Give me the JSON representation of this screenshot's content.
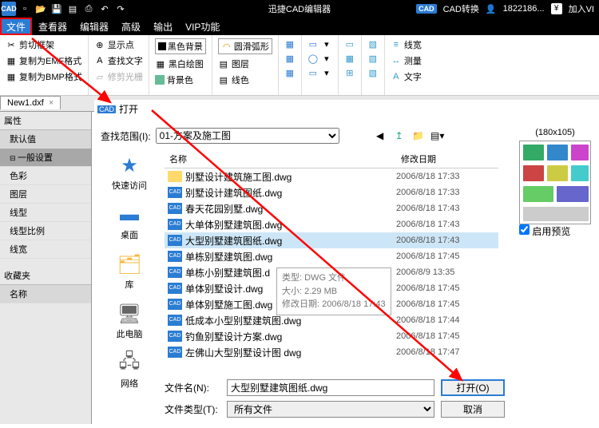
{
  "titlebar": {
    "app_title": "迅捷CAD编辑器",
    "cad_convert": "CAD转换",
    "user": "1822186...",
    "join_vip": "加入VI"
  },
  "menubar": {
    "file": "文件",
    "view": "查看器",
    "editor": "编辑器",
    "advanced": "高级",
    "output": "输出",
    "vip": "VIP功能"
  },
  "ribbon": {
    "g1": {
      "cut_frame": "剪切框架",
      "copy_emf": "复制为EMF格式",
      "copy_bmp": "复制为BMP格式"
    },
    "g2": {
      "show_point": "显示点",
      "find_text": "查找文字",
      "trim_cursor": "修剪光栅"
    },
    "g3": {
      "black_bg": "黑色背景",
      "bw_draw": "黑白绘图",
      "bg_color": "背景色"
    },
    "g4": {
      "smooth_arc": "圆滑弧形",
      "layer": "图层",
      "line_color": "线色"
    },
    "g5": {
      "line_width": "线宽",
      "measure": "测量",
      "text": "文字"
    }
  },
  "tab": {
    "name": "New1.dxf"
  },
  "leftpanel": {
    "props": "属性",
    "default": "默认值",
    "general": "一般设置",
    "rows": [
      "色彩",
      "图层",
      "线型",
      "线型比例",
      "线宽"
    ],
    "fav": "收藏夹",
    "name_label": "名称"
  },
  "dialog": {
    "title": "打开",
    "lookin_label": "查找范围(I):",
    "lookin_value": "01-方案及施工图",
    "places": {
      "quick": "快速访问",
      "desktop": "桌面",
      "lib": "库",
      "pc": "此电脑",
      "net": "网络"
    },
    "cols": {
      "name": "名称",
      "date": "修改日期",
      "extra": "^"
    },
    "files": [
      {
        "type": "fld",
        "name": "别墅设计建筑施工图.dwg",
        "date": "2006/8/18 17:33"
      },
      {
        "type": "dwg",
        "name": "别墅设计建筑图纸.dwg",
        "date": "2006/8/18 17:33"
      },
      {
        "type": "dwg",
        "name": "春天花园别墅.dwg",
        "date": "2006/8/18 17:43"
      },
      {
        "type": "dwg",
        "name": "大单体别墅建筑图.dwg",
        "date": "2006/8/18 17:43"
      },
      {
        "type": "dwg",
        "name": "大型别墅建筑图纸.dwg",
        "date": "2006/8/18 17:43",
        "sel": true
      },
      {
        "type": "dwg",
        "name": "单栋别墅建筑图.dwg",
        "date": "2006/8/18 17:45"
      },
      {
        "type": "dwg",
        "name": "单栋小别墅建筑图.d",
        "date": "2006/8/9 13:35"
      },
      {
        "type": "dwg",
        "name": "单体别墅设计.dwg",
        "date": "2006/8/18 17:45"
      },
      {
        "type": "dwg",
        "name": "单体别墅施工图.dwg",
        "date": "2006/8/18 17:45"
      },
      {
        "type": "dwg",
        "name": "低成本小型别墅建筑图.dwg",
        "date": "2006/8/18 17:44"
      },
      {
        "type": "dwg",
        "name": "钓鱼别墅设计方案.dwg",
        "date": "2006/8/18 17:45"
      },
      {
        "type": "dwg",
        "name": "左佛山大型别墅设计图 dwg",
        "date": "2006/8/18 17:47"
      }
    ],
    "tooltip": {
      "l1": "类型: DWG 文件",
      "l2": "大小: 2.29 MB",
      "l3": "修改日期: 2006/8/18 17:43"
    },
    "preview": {
      "size": "(180x105)",
      "enable": "启用预览"
    },
    "filename_label": "文件名(N):",
    "filename_value": "大型别墅建筑图纸.dwg",
    "filetype_label": "文件类型(T):",
    "filetype_value": "所有文件",
    "open_btn": "打开(O)",
    "cancel_btn": "取消"
  }
}
